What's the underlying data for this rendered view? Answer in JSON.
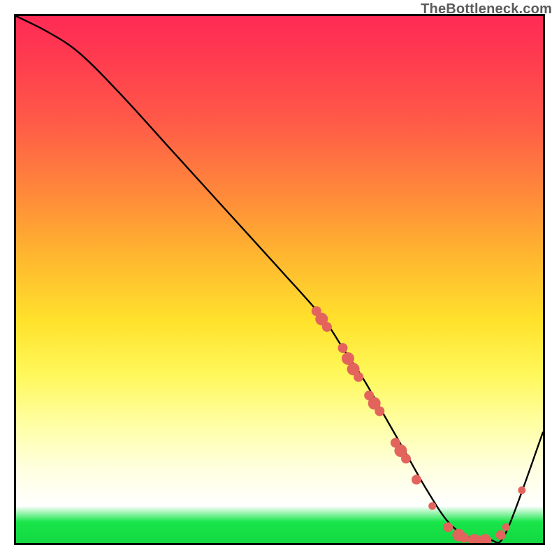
{
  "watermark": "TheBottleneck.com",
  "chart_data": {
    "type": "line",
    "title": "",
    "xlabel": "",
    "ylabel": "",
    "ylim": [
      0,
      100
    ],
    "xlim": [
      0,
      100
    ],
    "x": [
      0,
      6,
      12,
      20,
      30,
      40,
      50,
      58,
      62,
      66,
      70,
      74,
      78,
      82,
      86,
      90,
      93,
      100
    ],
    "values": [
      100,
      97,
      93,
      85,
      74,
      63,
      52,
      43,
      37,
      31,
      24,
      17,
      10,
      4,
      1,
      0.5,
      2,
      21
    ],
    "series": [
      {
        "name": "bottleneck-curve",
        "x": [
          0,
          6,
          12,
          20,
          30,
          40,
          50,
          58,
          62,
          66,
          70,
          74,
          78,
          82,
          86,
          90,
          93,
          100
        ],
        "values": [
          100,
          97,
          93,
          85,
          74,
          63,
          52,
          43,
          37,
          31,
          24,
          17,
          10,
          4,
          1,
          0.5,
          2,
          21
        ]
      }
    ],
    "markers": [
      {
        "x": 57,
        "y": 44,
        "size": "md"
      },
      {
        "x": 58,
        "y": 42.5,
        "size": "lg"
      },
      {
        "x": 59,
        "y": 41,
        "size": "md"
      },
      {
        "x": 62,
        "y": 37,
        "size": "md"
      },
      {
        "x": 63,
        "y": 35,
        "size": "lg"
      },
      {
        "x": 64,
        "y": 33,
        "size": "lg"
      },
      {
        "x": 65,
        "y": 31.5,
        "size": "md"
      },
      {
        "x": 67,
        "y": 28,
        "size": "md"
      },
      {
        "x": 68,
        "y": 26.5,
        "size": "lg"
      },
      {
        "x": 69,
        "y": 25,
        "size": "md"
      },
      {
        "x": 72,
        "y": 19,
        "size": "md"
      },
      {
        "x": 73,
        "y": 17.5,
        "size": "lg"
      },
      {
        "x": 74,
        "y": 16,
        "size": "md"
      },
      {
        "x": 76,
        "y": 12,
        "size": "md"
      },
      {
        "x": 79,
        "y": 7,
        "size": "sm"
      },
      {
        "x": 82,
        "y": 3,
        "size": "md"
      },
      {
        "x": 84,
        "y": 1.5,
        "size": "lg"
      },
      {
        "x": 85,
        "y": 1,
        "size": "md"
      },
      {
        "x": 87,
        "y": 0.5,
        "size": "lg"
      },
      {
        "x": 89,
        "y": 0.5,
        "size": "lg"
      },
      {
        "x": 92,
        "y": 1.5,
        "size": "md"
      },
      {
        "x": 93,
        "y": 3,
        "size": "sm"
      },
      {
        "x": 96,
        "y": 10,
        "size": "sm"
      }
    ],
    "marker_color": "#e3645c",
    "curve_color": "#000000",
    "background_gradient": [
      "#ff2a55",
      "#ffe22c",
      "#ffffff",
      "#13d842"
    ]
  }
}
